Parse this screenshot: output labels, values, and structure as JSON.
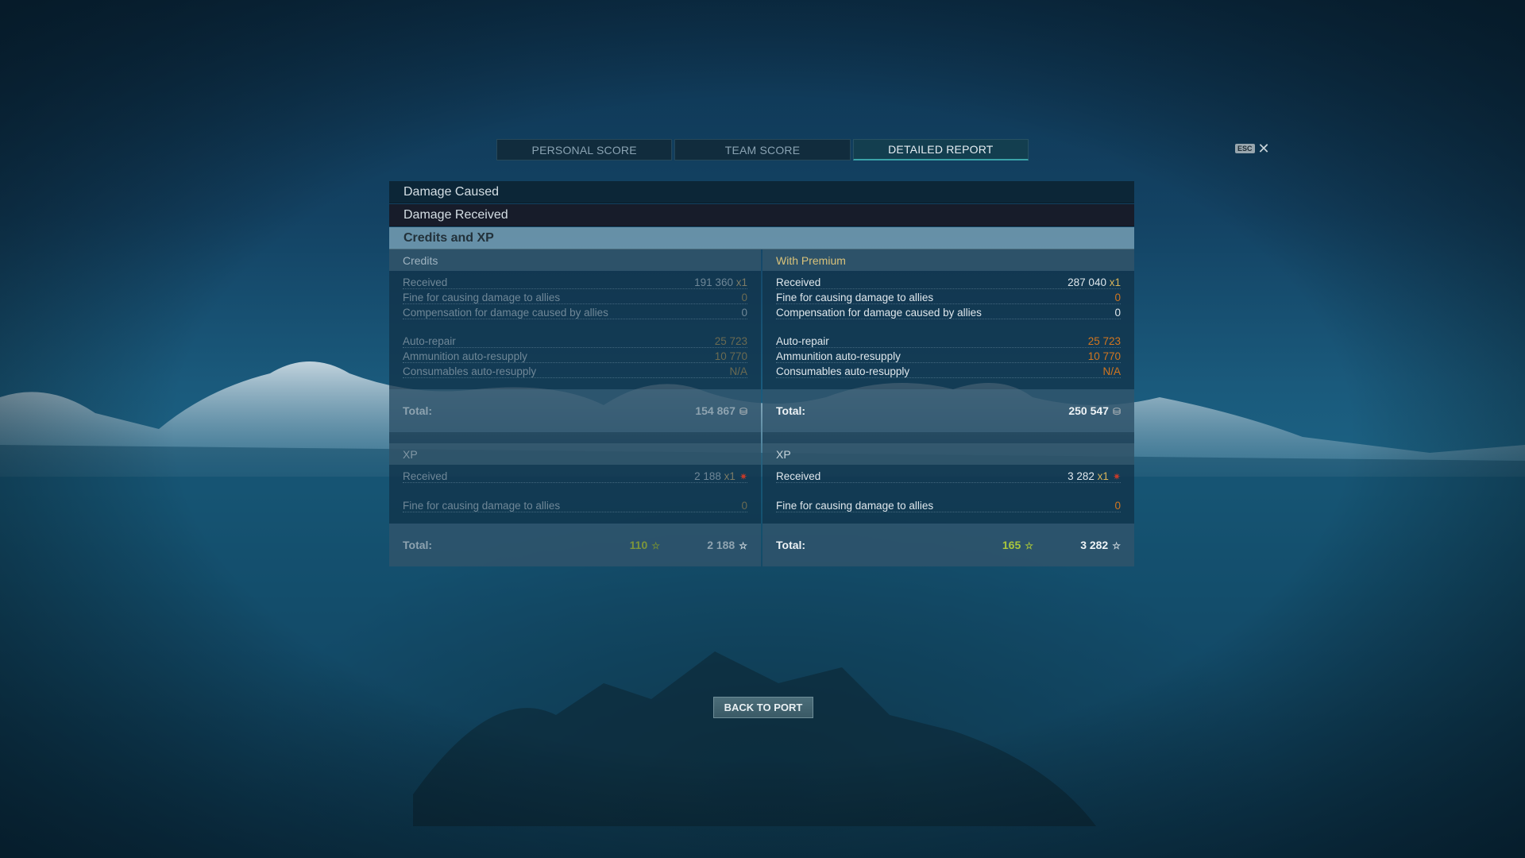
{
  "tabs": [
    {
      "label": "PERSONAL SCORE"
    },
    {
      "label": "TEAM SCORE"
    },
    {
      "label": "DETAILED REPORT"
    }
  ],
  "esc": {
    "key": "ESC",
    "close_glyph": "✕"
  },
  "sections": {
    "damage_caused": "Damage Caused",
    "damage_received": "Damage Received",
    "credits_xp": "Credits and XP"
  },
  "left": {
    "header": "Credits",
    "received_label": "Received",
    "received_value": "191 360",
    "received_mult": "x1",
    "fine_label": "Fine for causing damage to allies",
    "fine_value": "0",
    "comp_label": "Compensation for damage caused by allies",
    "comp_value": "0",
    "repair_label": "Auto-repair",
    "repair_value": "25 723",
    "ammo_label": "Ammunition auto-resupply",
    "ammo_value": "10 770",
    "cons_label": "Consumables auto-resupply",
    "cons_value": "N/A",
    "total_label": "Total:",
    "total_value": "154 867",
    "xp_header": "XP",
    "xp_received_label": "Received",
    "xp_received_value": "2 188",
    "xp_received_mult": "x1",
    "xp_fine_label": "Fine for causing damage to allies",
    "xp_fine_value": "0",
    "xp_total_label": "Total:",
    "xp_total_free": "110",
    "xp_total": "2 188"
  },
  "right": {
    "header": "With Premium",
    "received_label": "Received",
    "received_value": "287 040",
    "received_mult": "x1",
    "fine_label": "Fine for causing damage to allies",
    "fine_value": "0",
    "comp_label": "Compensation for damage caused by allies",
    "comp_value": "0",
    "repair_label": "Auto-repair",
    "repair_value": "25 723",
    "ammo_label": "Ammunition auto-resupply",
    "ammo_value": "10 770",
    "cons_label": "Consumables auto-resupply",
    "cons_value": "N/A",
    "total_label": "Total:",
    "total_value": "250 547",
    "xp_header": "XP",
    "xp_received_label": "Received",
    "xp_received_value": "3 282",
    "xp_received_mult": "x1",
    "xp_fine_label": "Fine for causing damage to allies",
    "xp_fine_value": "0",
    "xp_total_label": "Total:",
    "xp_total_free": "165",
    "xp_total": "3 282"
  },
  "back_button": "BACK TO PORT",
  "colors": {
    "accent_teal": "#3aa3a8",
    "orange": "#d2761f",
    "gold": "#d9c27a",
    "green": "#a9c63c"
  },
  "icons": {
    "credit": "credit-coin-icon",
    "free_xp": "star-icon",
    "xp": "star-outline-icon",
    "flag": "naval-flag-icon"
  }
}
